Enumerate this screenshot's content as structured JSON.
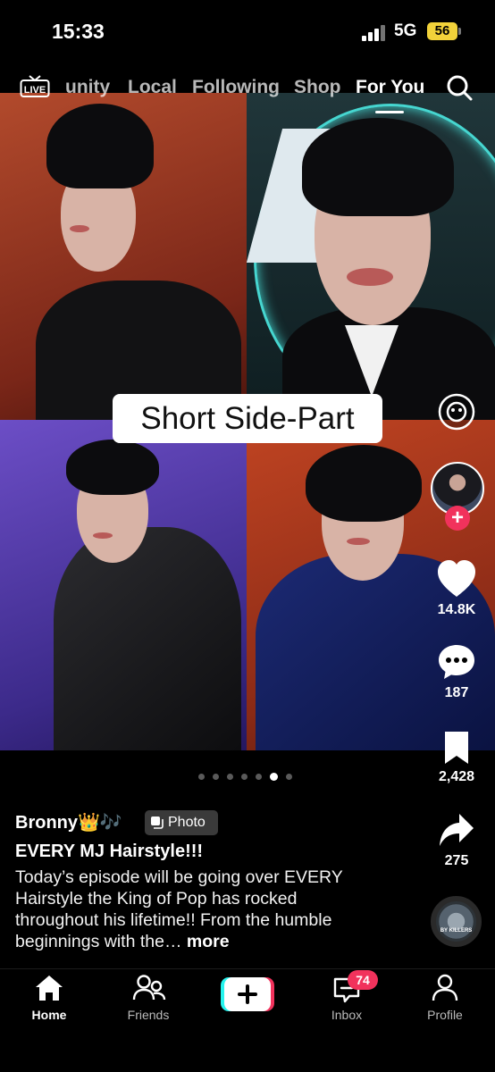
{
  "status_bar": {
    "time": "15:33",
    "network": "5G",
    "battery": "56"
  },
  "top_nav": {
    "live_label": "LIVE",
    "tabs": [
      "unity",
      "Local",
      "Following",
      "Shop",
      "For You"
    ],
    "active_tab": "For You"
  },
  "photo_caption": "Short Side-Part",
  "right_rail": {
    "likes": "14.8K",
    "comments": "187",
    "saves": "2,428",
    "shares": "275",
    "disc_text": "BY KILLERS"
  },
  "pagination": {
    "total": 7,
    "active_index": 5
  },
  "post": {
    "username": "Bronny👑🎶",
    "badge": "Photo",
    "title": "EVERY MJ Hairstyle!!!",
    "description": "Today’s episode will be going over EVERY Hairstyle the King of Pop has rocked throughout his lifetime!! From the humble beginnings with the…",
    "more": "more"
  },
  "tab_bar": {
    "items": [
      "Home",
      "Friends",
      "",
      "Inbox",
      "Profile"
    ],
    "inbox_badge": "74"
  },
  "colors": {
    "accent_red": "#f1325c",
    "battery": "#f2d23a",
    "tiktok_cyan": "#25f4ee"
  }
}
